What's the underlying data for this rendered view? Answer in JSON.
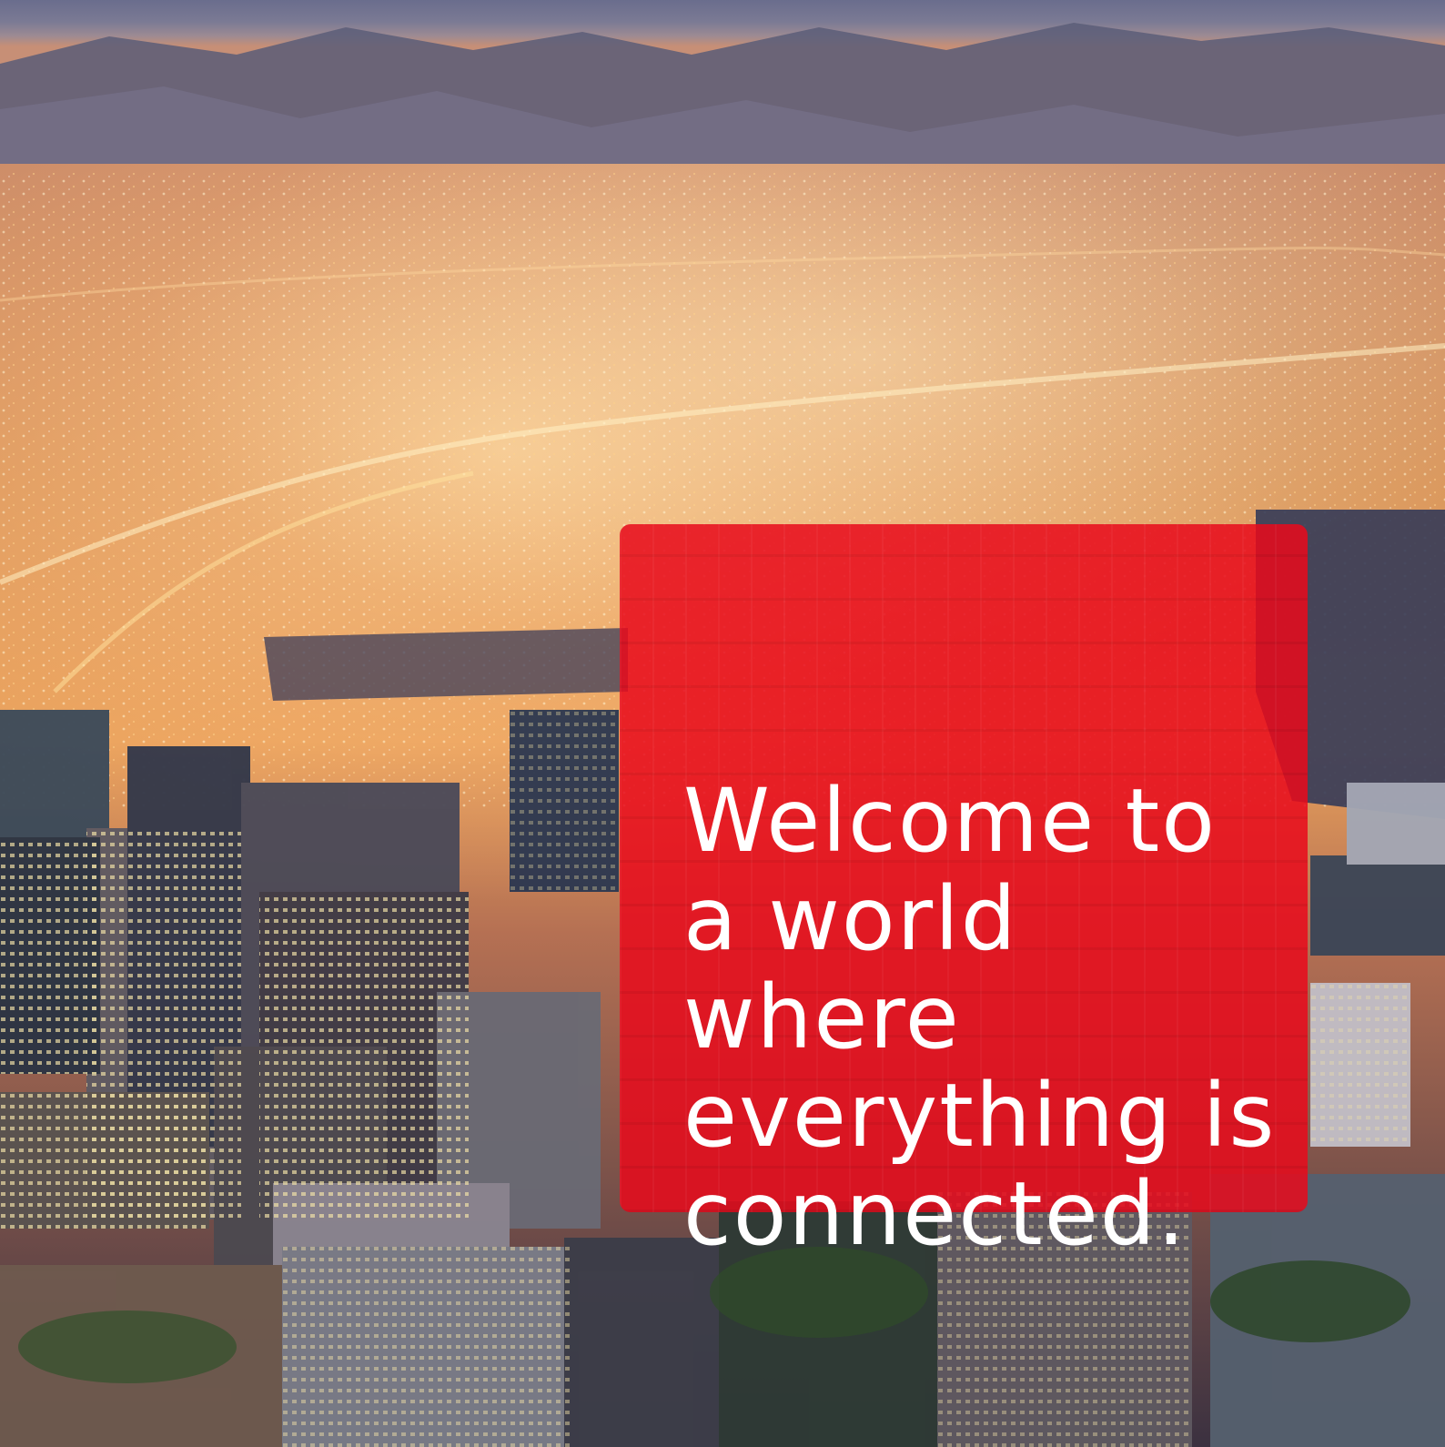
{
  "hero": {
    "headline": "Welcome to a world where everything is connected.",
    "accent_color": "#E60A1C"
  },
  "background": {
    "icon": "city-night-skyline-image"
  }
}
